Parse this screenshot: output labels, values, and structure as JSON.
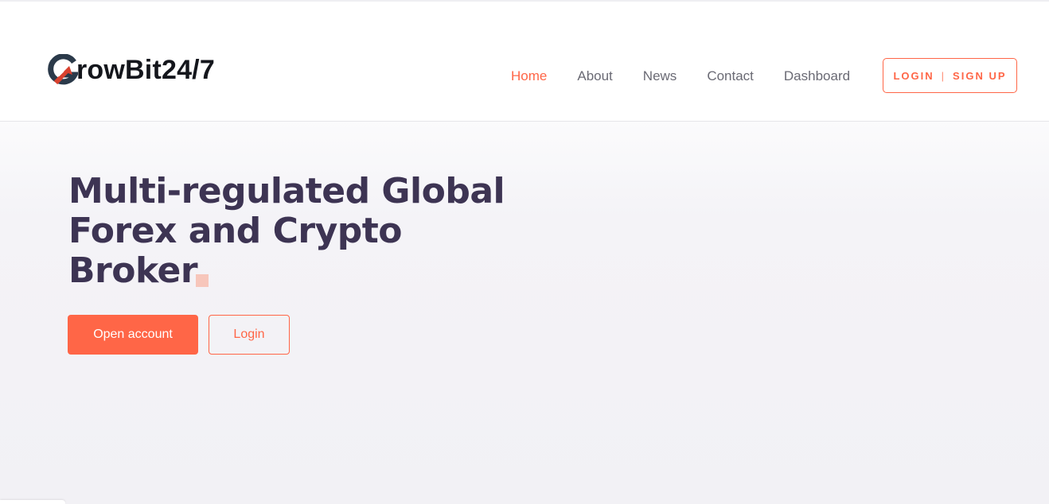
{
  "brand": {
    "name": "rowBit24/7",
    "logo_icon": "growbit-g-logo-icon",
    "colors": {
      "dark": "#2b3a4a",
      "accent": "#d9412e"
    }
  },
  "nav": {
    "items": [
      {
        "label": "Home",
        "active": true
      },
      {
        "label": "About",
        "active": false
      },
      {
        "label": "News",
        "active": false
      },
      {
        "label": "Contact",
        "active": false
      },
      {
        "label": "Dashboard",
        "active": false
      }
    ],
    "auth": {
      "login": "LOGIN",
      "separator": "|",
      "signup": "SIGN UP"
    }
  },
  "hero": {
    "headline_lines": [
      "Multi-regulated Global",
      "Forex and Crypto",
      "Broker"
    ],
    "primary_button": "Open account",
    "secondary_button": "Login"
  },
  "colors": {
    "accent": "#ff6647",
    "headline": "#3d3453",
    "nav_text": "#6a6a74"
  }
}
